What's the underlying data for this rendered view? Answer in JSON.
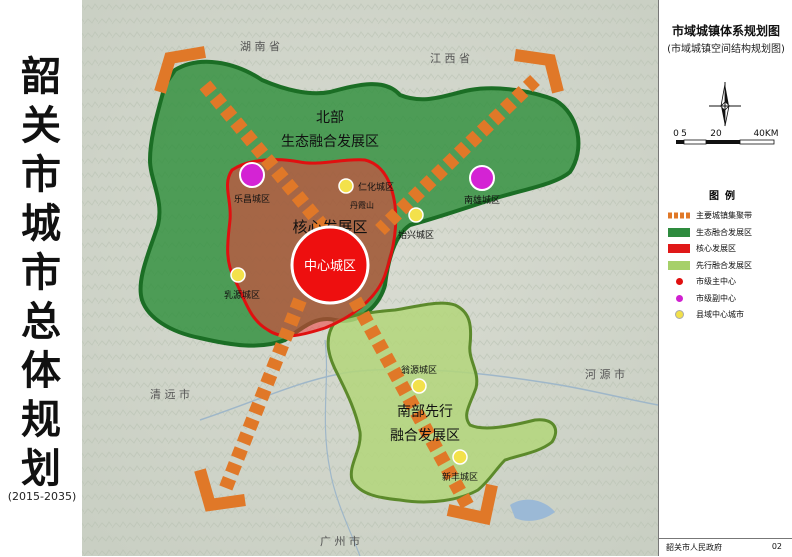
{
  "left_title": {
    "chars": [
      "韶",
      "关",
      "市",
      "城",
      "市",
      "总",
      "体",
      "规",
      "划"
    ],
    "years": "(2015-2035)"
  },
  "right_panel": {
    "title": "市域城镇体系规划图",
    "subtitle": "(市域城镇空间结构规划图)",
    "scale": {
      "zero": "0",
      "five": "5",
      "twenty": "20",
      "forty": "40KM"
    },
    "legend_title": "图例",
    "legend": [
      {
        "label": "主要城镇集聚带",
        "symbol": "dashed-band",
        "color": "#e07828"
      },
      {
        "label": "生态融合发展区",
        "symbol": "fill",
        "color": "#2e8b3e"
      },
      {
        "label": "核心发展区",
        "symbol": "fill",
        "color": "#e01818"
      },
      {
        "label": "先行融合发展区",
        "symbol": "fill",
        "color": "#a6d06a"
      },
      {
        "label": "市级主中心",
        "symbol": "dot",
        "color": "#e01010"
      },
      {
        "label": "市级副中心",
        "symbol": "dot",
        "color": "#d020d0"
      },
      {
        "label": "县域中心城市",
        "symbol": "dot",
        "color": "#f2e04a"
      }
    ],
    "footer": "韶关市人民政府",
    "page": "02"
  },
  "zones": {
    "north_line1": "北部",
    "north_line2": "生态融合发展区",
    "core": "核心发展区",
    "south_line1": "南部先行",
    "south_line2": "融合发展区"
  },
  "cities": {
    "center": "中心城区",
    "lechang": "乐昌城区",
    "renhua": "仁化城区",
    "danxia": "丹霞山",
    "shixing": "始兴城区",
    "nanxiong": "南雄城区",
    "ruyuan": "乳源城区",
    "wengyuan": "翁源城区",
    "xinfeng": "新丰城区"
  },
  "background": {
    "hunan": "湖 南 省",
    "jiangxi": "江 西 省",
    "qingyuan": "清 远 市",
    "heyuan": "河 源 市",
    "guangzhou": "广 州 市"
  },
  "colors": {
    "band": "#e07828",
    "eco_fill": "#2f8f3c",
    "core_fill": "#ef3a3a",
    "pilot_fill": "#b3d67a",
    "main_center": "#ee0f0f",
    "sub_center": "#d423d4",
    "county_center": "#f3e14b"
  }
}
